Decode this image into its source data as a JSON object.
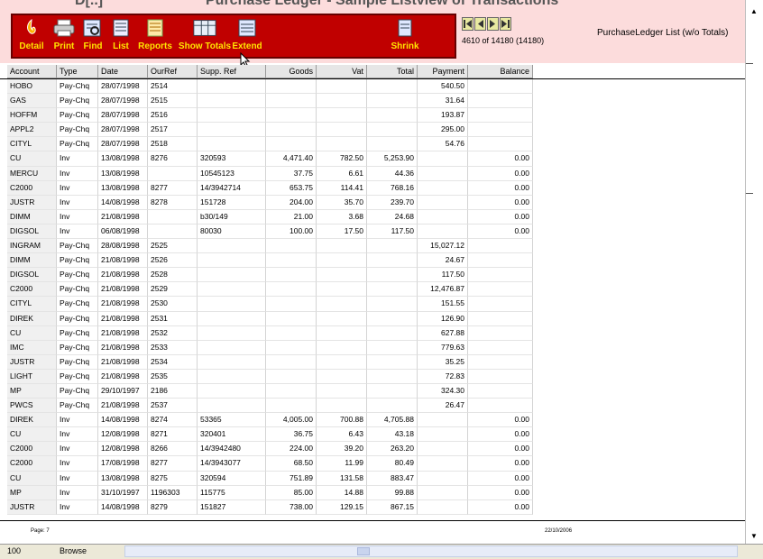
{
  "window": {
    "title_fragments": [
      "D[..]",
      "Purchase Ledger - Sample Listview of Transactions"
    ]
  },
  "toolbar": {
    "buttons": [
      {
        "label": "Detail",
        "icon": "detail-icon"
      },
      {
        "label": "Print",
        "icon": "printer-icon"
      },
      {
        "label": "Find",
        "icon": "find-icon"
      },
      {
        "label": "List",
        "icon": "list-icon"
      },
      {
        "label": "Reports",
        "icon": "reports-icon"
      },
      {
        "label": "Show Totals",
        "icon": "totals-icon"
      },
      {
        "label": "Extend",
        "icon": "extend-icon"
      },
      {
        "label": "Shrink",
        "icon": "shrink-icon"
      }
    ]
  },
  "navigation": {
    "buttons": [
      "first",
      "prev",
      "next",
      "last"
    ],
    "record_info": "4610 of 14180 (14180)"
  },
  "list_name": "PurchaseLedger List (w/o Totals)",
  "columns": [
    "Account",
    "Type",
    "Date",
    "OurRef",
    "Supp. Ref",
    "Goods",
    "Vat",
    "Total",
    "Payment",
    "Balance"
  ],
  "rows": [
    [
      "HOBO",
      "Pay-Chq",
      "28/07/1998",
      "2514",
      "",
      "",
      "",
      "",
      "540.50",
      ""
    ],
    [
      "GAS",
      "Pay-Chq",
      "28/07/1998",
      "2515",
      "",
      "",
      "",
      "",
      "31.64",
      ""
    ],
    [
      "HOFFM",
      "Pay-Chq",
      "28/07/1998",
      "2516",
      "",
      "",
      "",
      "",
      "193.87",
      ""
    ],
    [
      "APPL2",
      "Pay-Chq",
      "28/07/1998",
      "2517",
      "",
      "",
      "",
      "",
      "295.00",
      ""
    ],
    [
      "CITYL",
      "Pay-Chq",
      "28/07/1998",
      "2518",
      "",
      "",
      "",
      "",
      "54.76",
      ""
    ],
    [
      "CU",
      "Inv",
      "13/08/1998",
      "8276",
      "320593",
      "4,471.40",
      "782.50",
      "5,253.90",
      "",
      "0.00"
    ],
    [
      "MERCU",
      "Inv",
      "13/08/1998",
      "",
      "10545123",
      "37.75",
      "6.61",
      "44.36",
      "",
      "0.00"
    ],
    [
      "C2000",
      "Inv",
      "13/08/1998",
      "8277",
      "14/3942714",
      "653.75",
      "114.41",
      "768.16",
      "",
      "0.00"
    ],
    [
      "JUSTR",
      "Inv",
      "14/08/1998",
      "8278",
      "151728",
      "204.00",
      "35.70",
      "239.70",
      "",
      "0.00"
    ],
    [
      "DIMM",
      "Inv",
      "21/08/1998",
      "",
      "b30/149",
      "21.00",
      "3.68",
      "24.68",
      "",
      "0.00"
    ],
    [
      "DIGSOL",
      "Inv",
      "06/08/1998",
      "",
      "80030",
      "100.00",
      "17.50",
      "117.50",
      "",
      "0.00"
    ],
    [
      "INGRAM",
      "Pay-Chq",
      "28/08/1998",
      "2525",
      "",
      "",
      "",
      "",
      "15,027.12",
      ""
    ],
    [
      "DIMM",
      "Pay-Chq",
      "21/08/1998",
      "2526",
      "",
      "",
      "",
      "",
      "24.67",
      ""
    ],
    [
      "DIGSOL",
      "Pay-Chq",
      "21/08/1998",
      "2528",
      "",
      "",
      "",
      "",
      "117.50",
      ""
    ],
    [
      "C2000",
      "Pay-Chq",
      "21/08/1998",
      "2529",
      "",
      "",
      "",
      "",
      "12,476.87",
      ""
    ],
    [
      "CITYL",
      "Pay-Chq",
      "21/08/1998",
      "2530",
      "",
      "",
      "",
      "",
      "151.55",
      ""
    ],
    [
      "DIREK",
      "Pay-Chq",
      "21/08/1998",
      "2531",
      "",
      "",
      "",
      "",
      "126.90",
      ""
    ],
    [
      "CU",
      "Pay-Chq",
      "21/08/1998",
      "2532",
      "",
      "",
      "",
      "",
      "627.88",
      ""
    ],
    [
      "IMC",
      "Pay-Chq",
      "21/08/1998",
      "2533",
      "",
      "",
      "",
      "",
      "779.63",
      ""
    ],
    [
      "JUSTR",
      "Pay-Chq",
      "21/08/1998",
      "2534",
      "",
      "",
      "",
      "",
      "35.25",
      ""
    ],
    [
      "LIGHT",
      "Pay-Chq",
      "21/08/1998",
      "2535",
      "",
      "",
      "",
      "",
      "72.83",
      ""
    ],
    [
      "MP",
      "Pay-Chq",
      "29/10/1997",
      "2186",
      "",
      "",
      "",
      "",
      "324.30",
      ""
    ],
    [
      "PWCS",
      "Pay-Chq",
      "21/08/1998",
      "2537",
      "",
      "",
      "",
      "",
      "26.47",
      ""
    ],
    [
      "DIREK",
      "Inv",
      "14/08/1998",
      "8274",
      "53365",
      "4,005.00",
      "700.88",
      "4,705.88",
      "",
      "0.00"
    ],
    [
      "CU",
      "Inv",
      "12/08/1998",
      "8271",
      "320401",
      "36.75",
      "6.43",
      "43.18",
      "",
      "0.00"
    ],
    [
      "C2000",
      "Inv",
      "12/08/1998",
      "8266",
      "14/3942480",
      "224.00",
      "39.20",
      "263.20",
      "",
      "0.00"
    ],
    [
      "C2000",
      "Inv",
      "17/08/1998",
      "8277",
      "14/3943077",
      "68.50",
      "11.99",
      "80.49",
      "",
      "0.00"
    ],
    [
      "CU",
      "Inv",
      "13/08/1998",
      "8275",
      "320594",
      "751.89",
      "131.58",
      "883.47",
      "",
      "0.00"
    ],
    [
      "MP",
      "Inv",
      "31/10/1997",
      "1196303",
      "115775",
      "85.00",
      "14.88",
      "99.88",
      "",
      "0.00"
    ],
    [
      "JUSTR",
      "Inv",
      "14/08/1998",
      "8279",
      "151827",
      "738.00",
      "129.15",
      "867.15",
      "",
      "0.00"
    ]
  ],
  "footer": {
    "page_label": "Page: 7",
    "date": "22/10/2006"
  },
  "statusbar": {
    "zoom": "100",
    "mode": "Browse"
  },
  "colors": {
    "header_band": "#fcdcdc",
    "toolbar_bg": "#c00000",
    "toolbar_label": "#ffe400"
  }
}
